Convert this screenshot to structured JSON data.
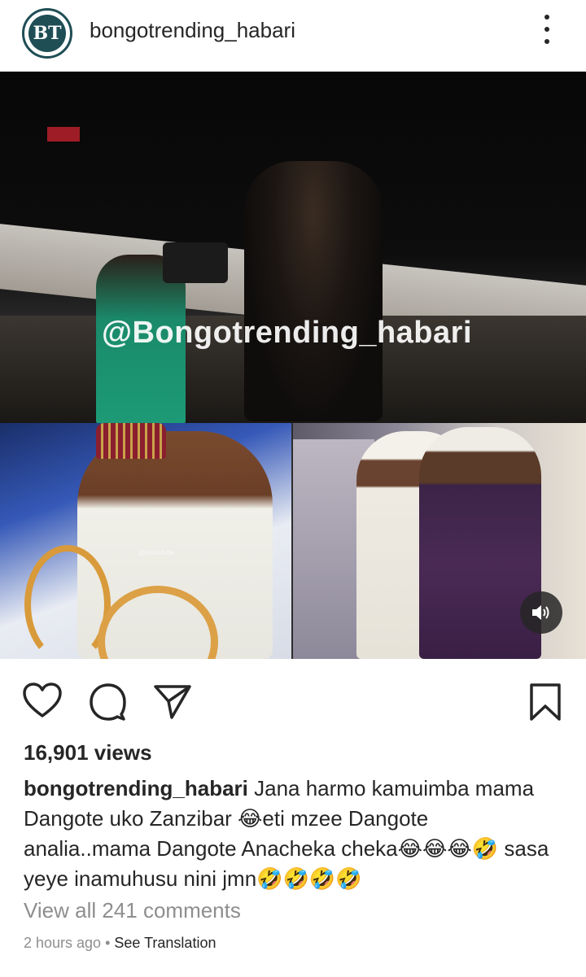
{
  "header": {
    "avatar_text": "BT",
    "username": "bongotrending_habari"
  },
  "media": {
    "watermark": "@Bongotrending_habari",
    "small_watermark": "@phorotube"
  },
  "post": {
    "views": "16,901 views",
    "caption_username": "bongotrending_habari",
    "caption_text": " Jana harmo kamuimba mama Dangote uko Zanzibar 😂eti mzee Dangote analia..mama Dangote Anacheka cheka😂😂😂🤣 sasa yeye inamuhusu nini jmn🤣🤣🤣🤣",
    "comments_link": "View all 241 comments",
    "timestamp": "2 hours ago",
    "separator": " • ",
    "translate_link": "See Translation"
  },
  "icons": {
    "like": "heart-icon",
    "comment": "comment-icon",
    "share": "paper-plane-icon",
    "save": "bookmark-icon",
    "more": "more-vertical-icon",
    "sound": "speaker-icon"
  },
  "colors": {
    "avatar_ring": "#1f4e55",
    "text_primary": "#262626",
    "text_secondary": "#8e8e8e"
  }
}
